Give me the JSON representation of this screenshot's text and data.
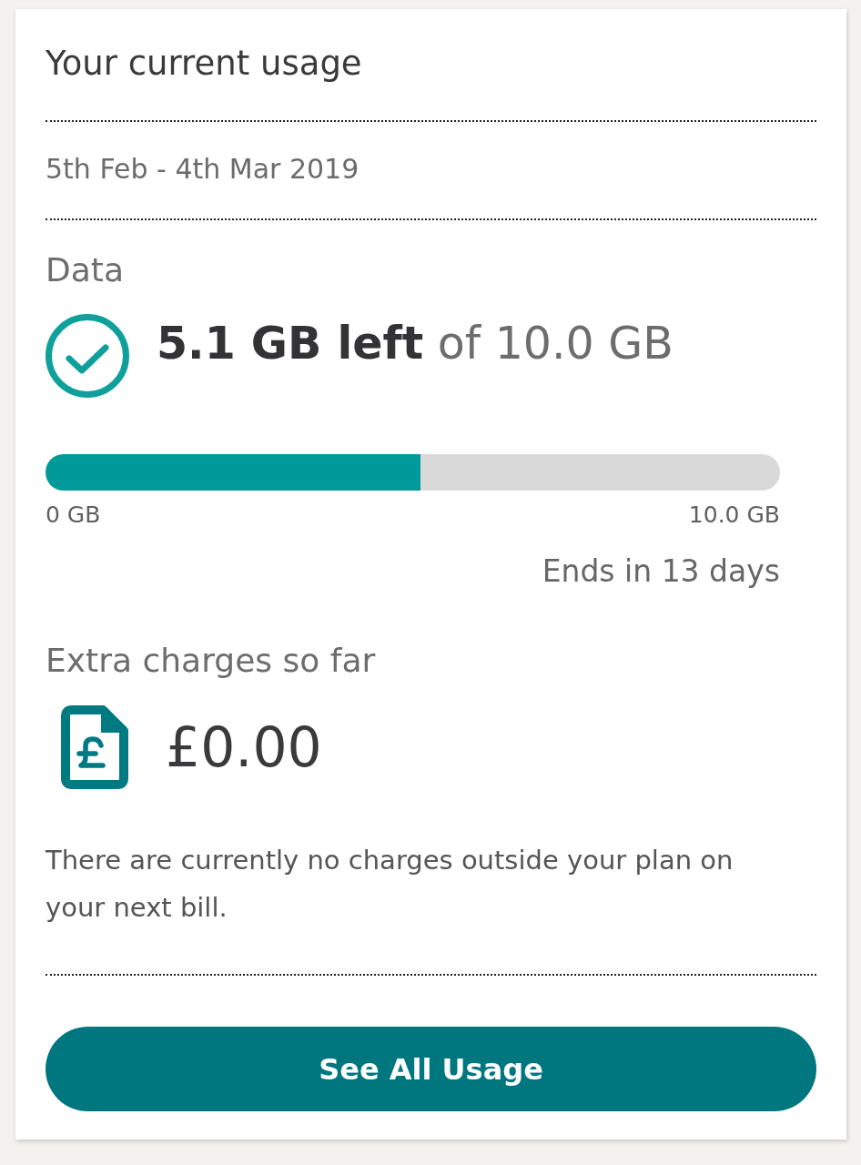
{
  "card": {
    "title": "Your current usage",
    "period": "5th Feb - 4th Mar 2019"
  },
  "data": {
    "heading": "Data",
    "amount_left": "5.1 GB left",
    "amount_total": "of 10.0 GB",
    "level": 0.51,
    "min_label": "0 GB",
    "max_label": "10.0 GB",
    "ends": "Ends in 13 days"
  },
  "extra_charges": {
    "heading": "Extra charges so far",
    "amount": "£0.00",
    "note": "There are currently no charges outside your plan on your next bill."
  },
  "button": {
    "label": "See All Usage"
  }
}
